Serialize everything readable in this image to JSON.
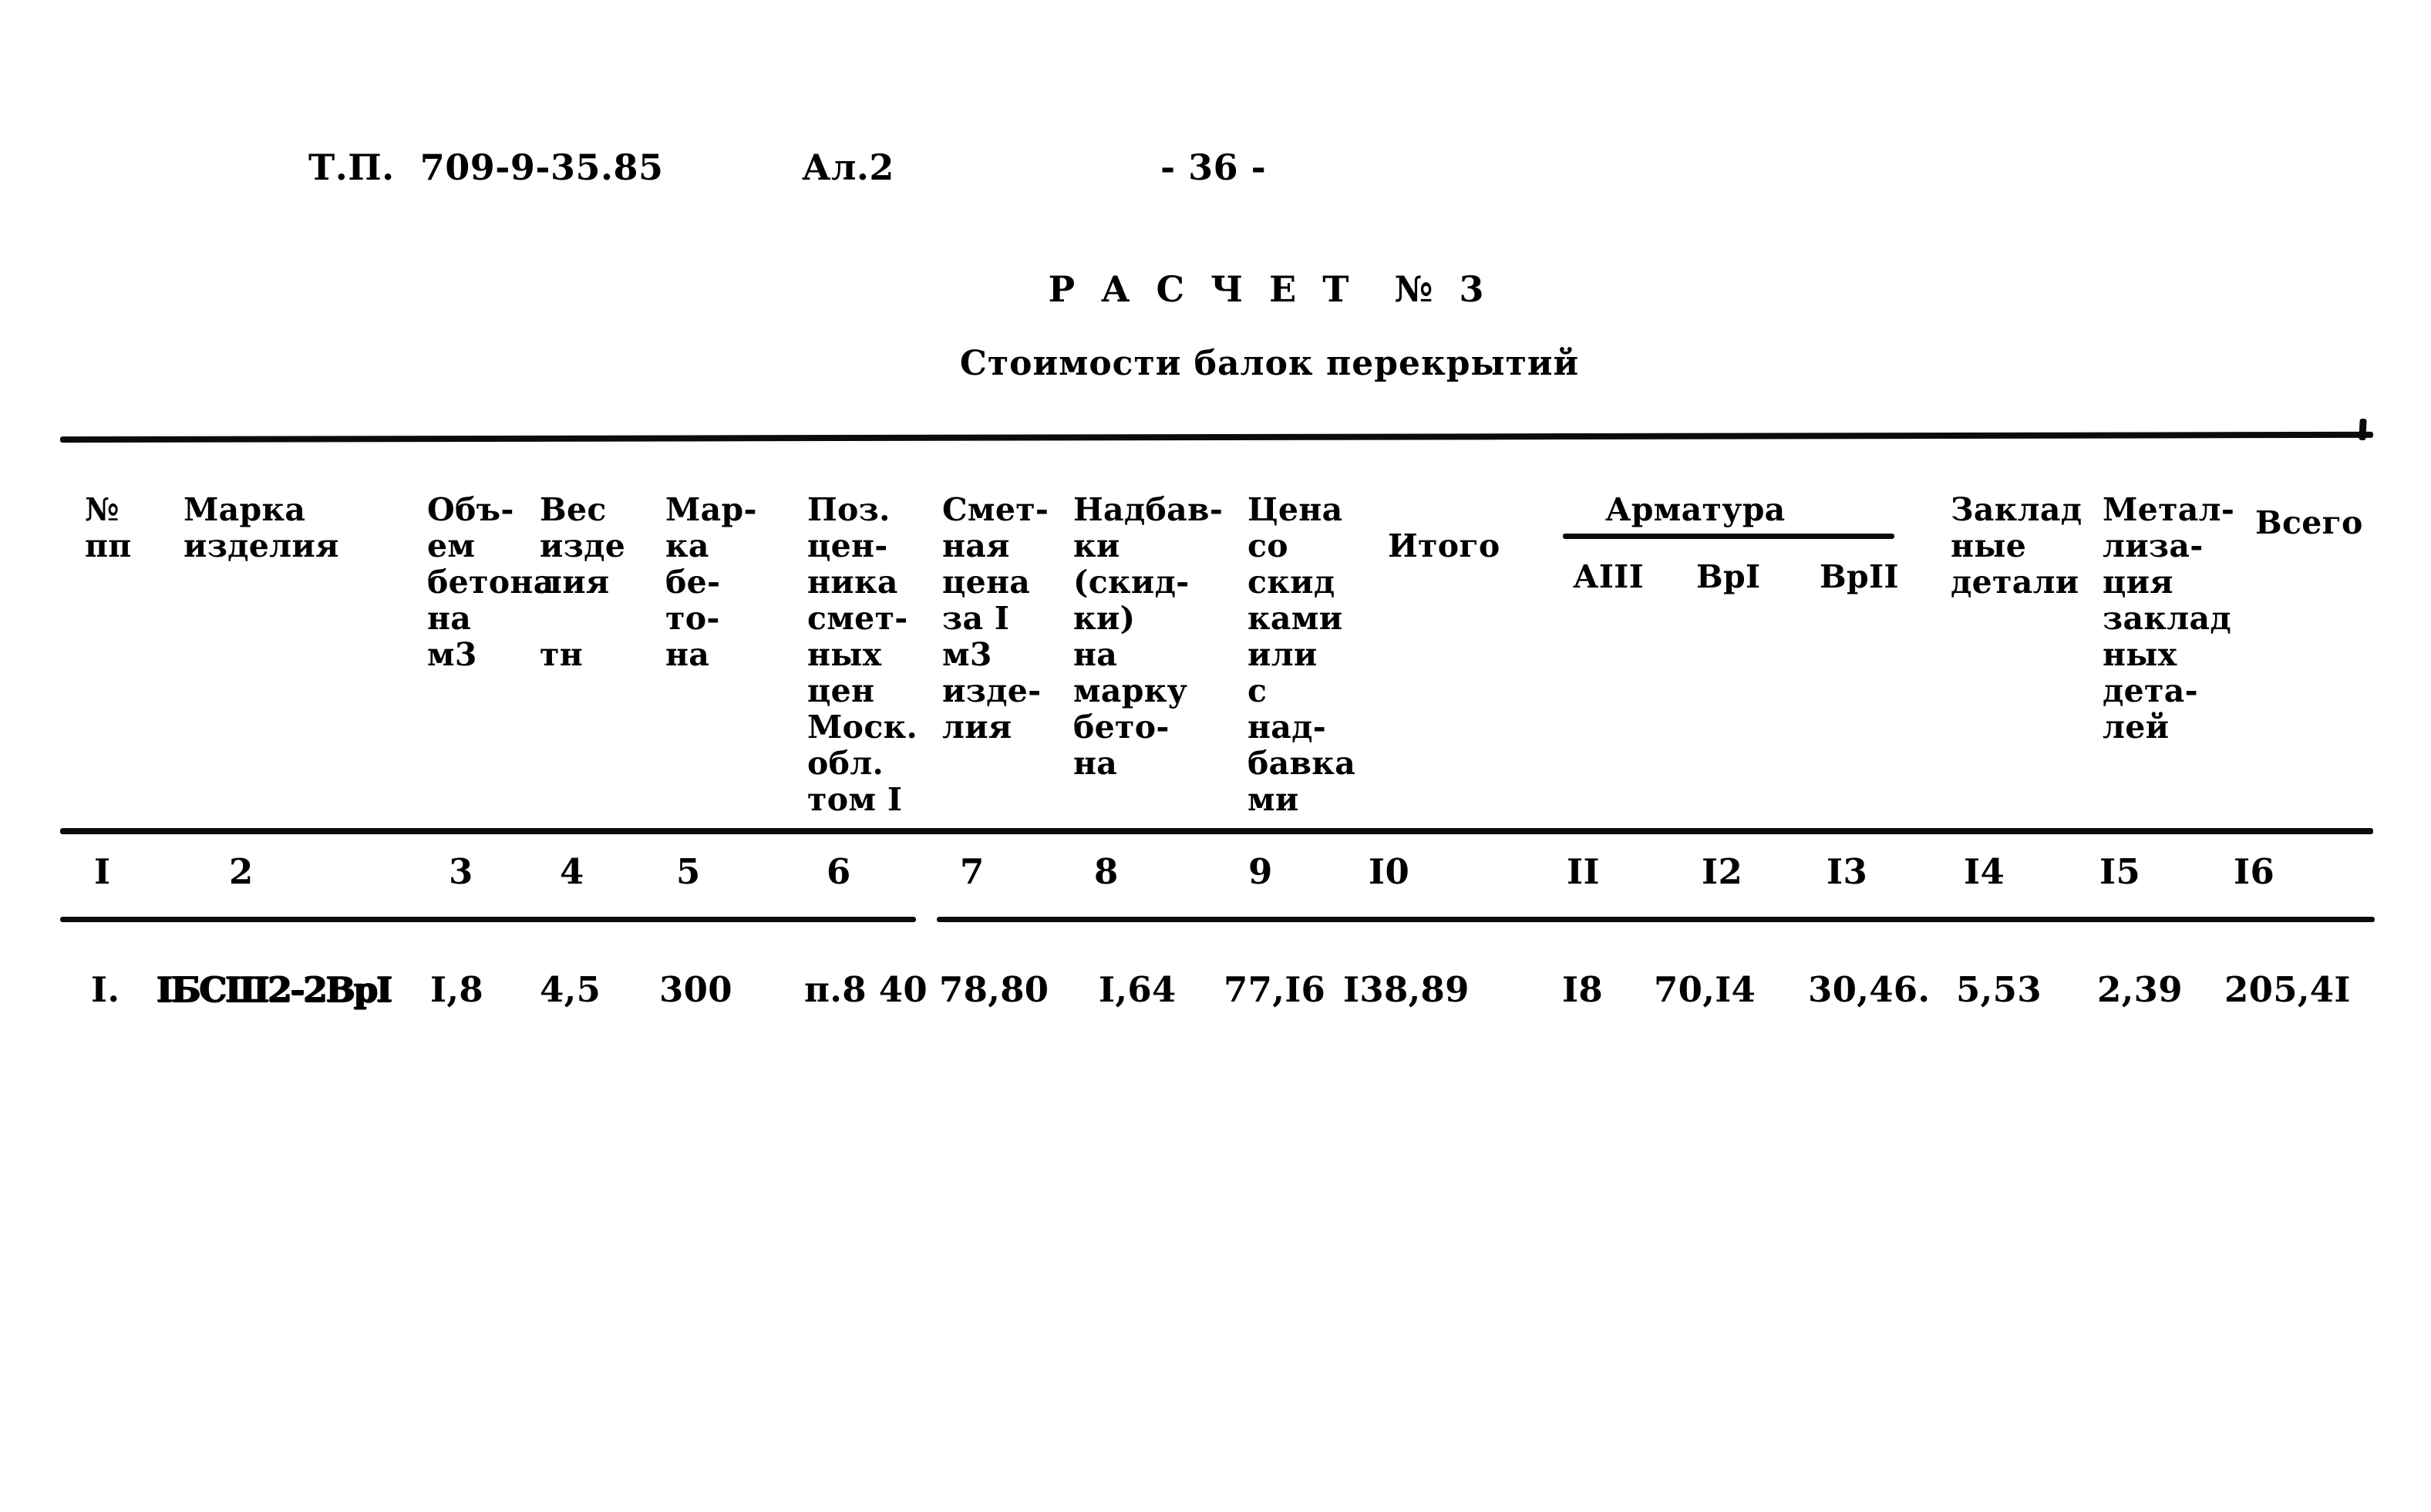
{
  "running_head": {
    "doc_code": "Т.П.  709-9-35.85",
    "album": "Ал.2",
    "page_number": "- 36 -"
  },
  "title": {
    "calc_label": "Р А С Ч Е Т  № 3",
    "subtitle": "Стоимости балок перекрытий"
  },
  "table": {
    "group_header": {
      "armatura": "Арматура"
    },
    "headers": [
      {
        "col": "1",
        "text": "№\nпп"
      },
      {
        "col": "2",
        "text": "Марка\nизделия"
      },
      {
        "col": "3",
        "text": "Объ-\nем\nбетона\nна\nм3"
      },
      {
        "col": "4",
        "text": "Вес\nизде\nлия\n\nтн"
      },
      {
        "col": "5",
        "text": "Мар-\nка\nбе-\nто-\nна"
      },
      {
        "col": "6",
        "text": "Поз.\nцен-\nника\nсмет-\nных\nцен\nМоск.\nобл.\nтом I"
      },
      {
        "col": "7",
        "text": "Смет-\nная\nцена\nза I\nм3\nизде-\nлия"
      },
      {
        "col": "8",
        "text": "Надбав-\nки\n(скид-\nки)\nна\nмарку\nбето-\nна"
      },
      {
        "col": "9",
        "text": "Цена\nсо\nскид\nками\nили\nс\nнад-\nбавка\nми"
      },
      {
        "col": "10",
        "text": "Итого"
      },
      {
        "col": "11",
        "text": "АIII"
      },
      {
        "col": "12",
        "text": "ВрI"
      },
      {
        "col": "13",
        "text": "ВрII"
      },
      {
        "col": "14",
        "text": "Заклад\nные\nдетали"
      },
      {
        "col": "15",
        "text": "Метал-\nлиза-\nция\nзаклад\nных\nдета-\nлей"
      },
      {
        "col": "16",
        "text": "Всего"
      }
    ],
    "column_numbers": [
      "I",
      "2",
      "3",
      "4",
      "5",
      "6",
      "7",
      "8",
      "9",
      "I0",
      "II",
      "I2",
      "I3",
      "I4",
      "I5",
      "I6"
    ],
    "rows": [
      {
        "c1": "I.",
        "c2": "IБСШ2-2ВрI",
        "c3": "I,8",
        "c4": "4,5",
        "c5": "300",
        "c6": "п.8 40",
        "c7": "78,80",
        "c8": "I,64",
        "c9": "77,I6",
        "c10": "I38,89",
        "c11": "I8",
        "c12": "70,I4",
        "c13": "30,46.",
        "c14": "5,53",
        "c15": "2,39",
        "c16": "205,4I"
      }
    ]
  }
}
